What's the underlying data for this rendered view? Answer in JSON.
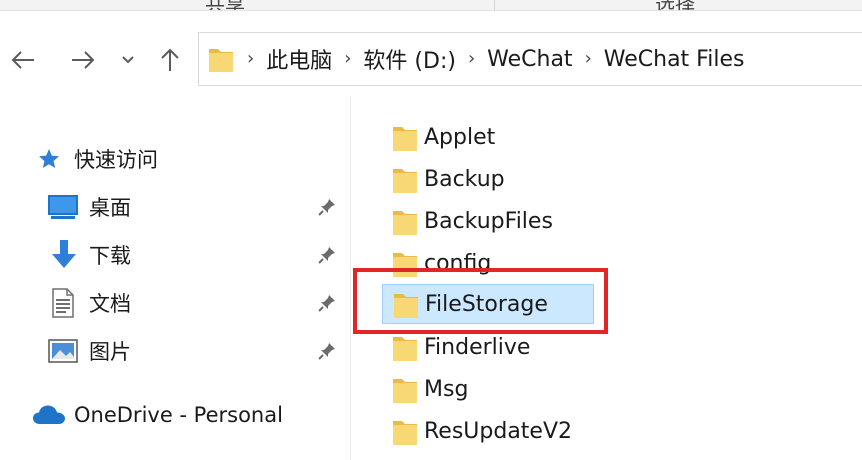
{
  "ribbon": {
    "left_fragment": "共享",
    "right_fragment": "选择"
  },
  "nav": {
    "back_icon": "arrow-left-icon",
    "forward_icon": "arrow-right-icon",
    "recent_icon": "chevron-down-icon",
    "up_icon": "arrow-up-icon"
  },
  "address": {
    "crumbs": [
      "此电脑",
      "软件 (D:)",
      "WeChat",
      "WeChat Files"
    ]
  },
  "sidebar": {
    "quick_access": "快速访问",
    "items": [
      {
        "label": "桌面",
        "icon": "desktop-icon",
        "pinned": true
      },
      {
        "label": "下载",
        "icon": "download-icon",
        "pinned": true
      },
      {
        "label": "文档",
        "icon": "document-icon",
        "pinned": true
      },
      {
        "label": "图片",
        "icon": "pictures-icon",
        "pinned": true
      }
    ],
    "onedrive": "OneDrive - Personal"
  },
  "files": [
    {
      "name": "Applet"
    },
    {
      "name": "Backup"
    },
    {
      "name": "BackupFiles"
    },
    {
      "name": "config"
    },
    {
      "name": "FileStorage",
      "selected": true
    },
    {
      "name": "Finderlive"
    },
    {
      "name": "Msg"
    },
    {
      "name": "ResUpdateV2"
    }
  ],
  "colors": {
    "folder": "#f8d775",
    "folder_dark": "#e9b949",
    "selection": "#cce8ff",
    "highlight_box": "#e02626"
  }
}
